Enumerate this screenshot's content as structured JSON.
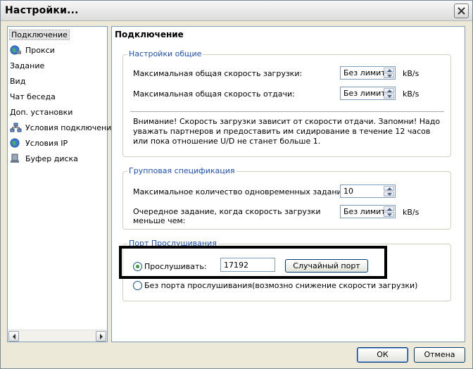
{
  "window": {
    "title": "Настройки..."
  },
  "sidebar": {
    "items": [
      {
        "label": "Подключение",
        "icon": "none",
        "selected": true
      },
      {
        "label": "Прокси",
        "icon": "globe-icon"
      },
      {
        "label": "Задание",
        "icon": "none"
      },
      {
        "label": "Вид",
        "icon": "none"
      },
      {
        "label": "Чат беседа",
        "icon": "none"
      },
      {
        "label": "Доп. установки",
        "icon": "none"
      },
      {
        "label": "Условия подключения",
        "icon": "network-icon"
      },
      {
        "label": "Условия IP",
        "icon": "globe-icon"
      },
      {
        "label": "Буфер диска",
        "icon": "disk-icon"
      }
    ]
  },
  "main": {
    "title": "Подключение",
    "general": {
      "legend": "Настройки общие",
      "download_label": "Максимальная общая скорость загрузки:",
      "download_value": "Без лимит",
      "upload_label": "Максимальная общая скорость отдачи:",
      "upload_value": "Без лимит",
      "unit": "kB/s",
      "warning": "Внимание! Скорость загрузки зависит от скорости отдачи. Запомни! Надо уважать партнеров и предоставить им сидирование в течение 12 часов или пока отношение U/D не станет больше 1."
    },
    "group_spec": {
      "legend": "Групповая спецификация",
      "max_tasks_label": "Максимальное количество одновременных заданий:",
      "max_tasks_value": "10",
      "next_task_label": "Очередное задание, когда скорость загрузки меньше чем:",
      "next_task_value": "Без лимит",
      "unit": "kB/s"
    },
    "listen_port": {
      "legend": "Порт Прослушивания",
      "listen_label": "Прослушивать:",
      "port_value": "17192",
      "random_port_button": "Случайный порт",
      "no_port_label": "Без порта прослушивания(возмозно снижение скорости загрузки)"
    }
  },
  "footer": {
    "ok": "ОК",
    "cancel": "Отмена"
  },
  "colors": {
    "legend": "#1f4fb5",
    "radio_dot": "#3b9b3b",
    "border": "#7f9db9"
  }
}
